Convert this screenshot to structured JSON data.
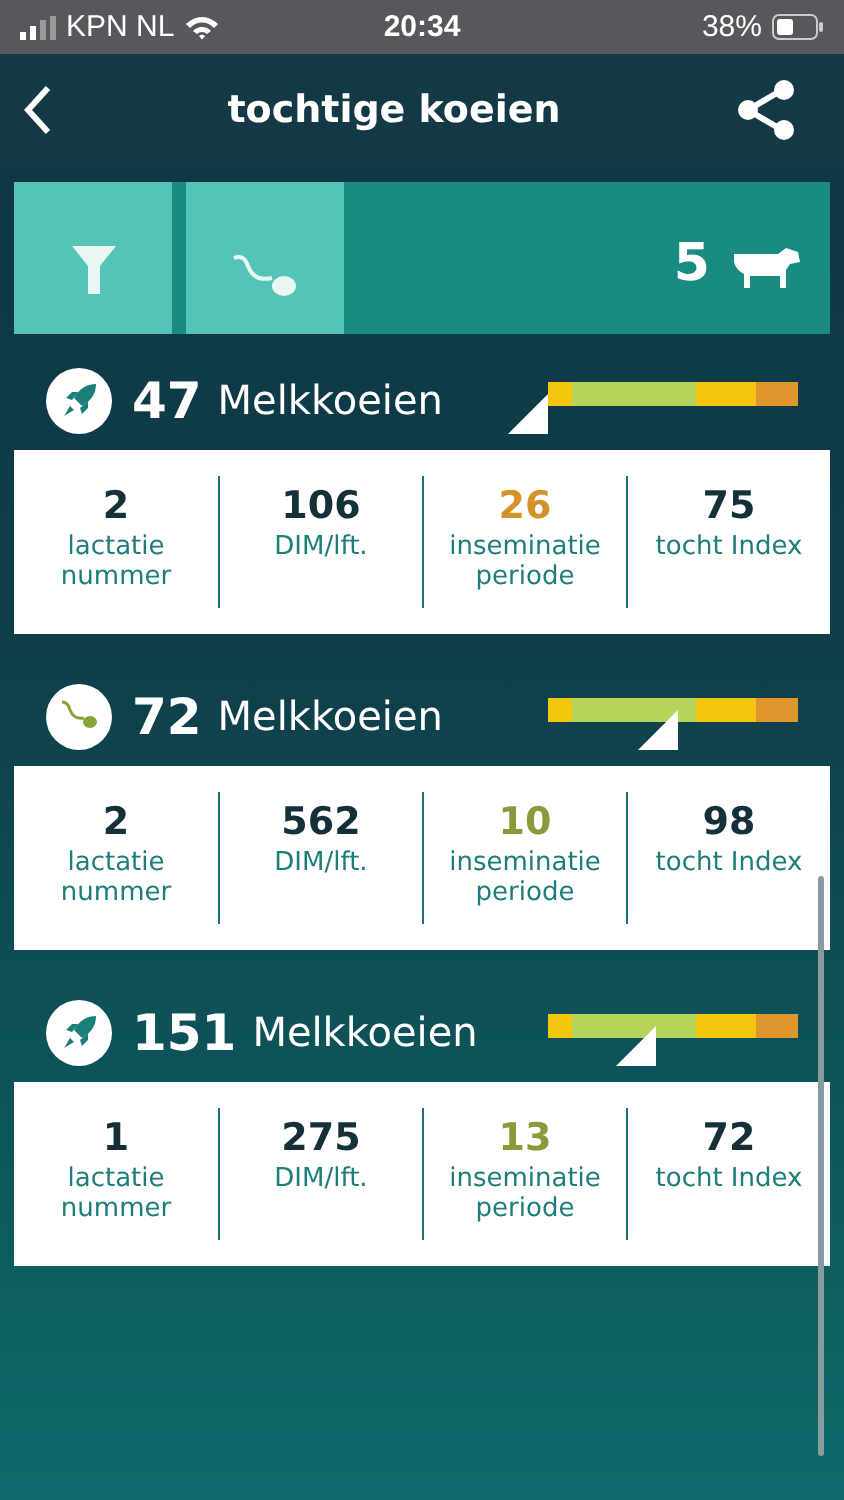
{
  "status_bar": {
    "carrier": "KPN NL",
    "time": "20:34",
    "battery": "38%"
  },
  "header": {
    "title": "tochtige koeien"
  },
  "filter_bar": {
    "buttons": [
      {
        "kind": "filter"
      },
      {
        "kind": "sperm"
      }
    ],
    "count": "5"
  },
  "cows": [
    {
      "kind": "rocket",
      "number": "47",
      "group": "Melkkoeien",
      "stats": [
        {
          "value": "2",
          "label": "lactatie nummer"
        },
        {
          "value": "106",
          "label": "DIM/lft."
        },
        {
          "value": "26",
          "label": "inseminatie periode",
          "color": "#d4922a"
        },
        {
          "value": "75",
          "label": "tocht Index"
        }
      ]
    },
    {
      "kind": "sperm",
      "number": "72",
      "group": "Melkkoeien",
      "stats": [
        {
          "value": "2",
          "label": "lactatie nummer"
        },
        {
          "value": "562",
          "label": "DIM/lft."
        },
        {
          "value": "10",
          "label": "inseminatie periode",
          "color": "#8a9a3a"
        },
        {
          "value": "98",
          "label": "tocht Index"
        }
      ]
    },
    {
      "kind": "rocket",
      "number": "151",
      "group": "Melkkoeien",
      "stats": [
        {
          "value": "1",
          "label": "lactatie nummer"
        },
        {
          "value": "275",
          "label": "DIM/lft."
        },
        {
          "value": "13",
          "label": "inseminatie periode",
          "color": "#8a9a3a"
        },
        {
          "value": "72",
          "label": "tocht Index"
        }
      ]
    }
  ]
}
